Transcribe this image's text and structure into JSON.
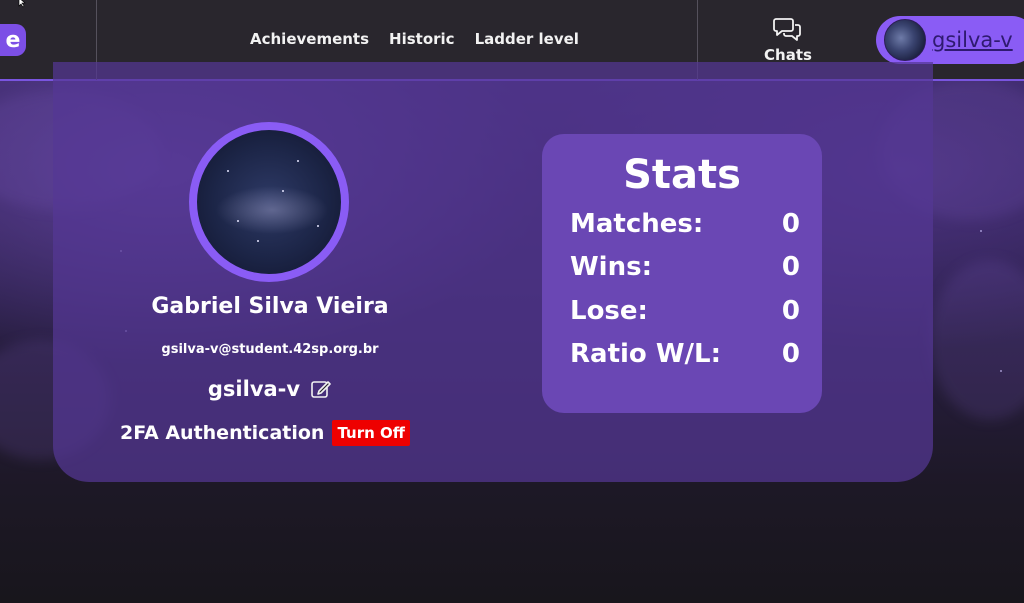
{
  "navbar": {
    "logo_letter": "e",
    "links": [
      "Achievements",
      "Historic",
      "Ladder level"
    ],
    "chats_label": "Chats",
    "chats_icon": "chat-bubbles-icon",
    "username": "gsilva-v"
  },
  "profile": {
    "full_name": "Gabriel Silva Vieira",
    "email": "gsilva-v@student.42sp.org.br",
    "nickname": "gsilva-v",
    "edit_icon": "edit-icon",
    "twofa_label": "2FA Authentication",
    "twofa_button": "Turn Off"
  },
  "stats": {
    "title": "Stats",
    "rows": [
      {
        "label": "Matches:",
        "value": "0"
      },
      {
        "label": "Wins:",
        "value": "0"
      },
      {
        "label": "Lose:",
        "value": "0"
      },
      {
        "label": "Ratio W/L:",
        "value": "0"
      }
    ]
  },
  "colors": {
    "accent": "#8a5cf5",
    "navbar_bg": "#29262d",
    "stats_bg": "#6a47b4",
    "danger": "#ee0000"
  }
}
